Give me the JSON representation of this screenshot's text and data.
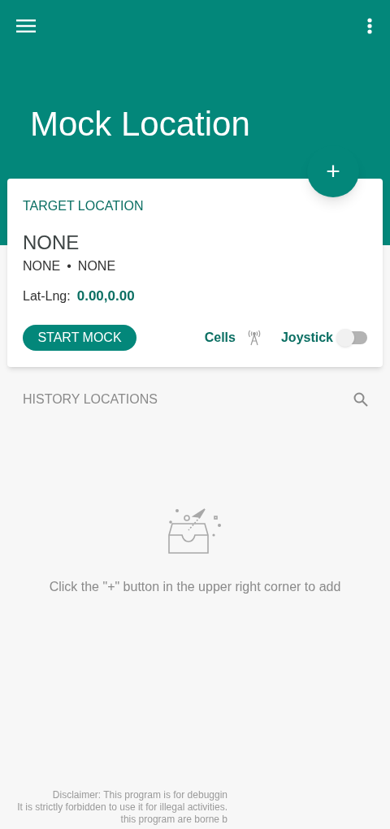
{
  "header": {
    "title": "Mock Location"
  },
  "fab": {
    "label": "+"
  },
  "target": {
    "heading": "TARGET LOCATION",
    "name": "NONE",
    "region": "NONE",
    "separator": "•",
    "locality": "NONE",
    "latlng_label": "Lat-Lng:",
    "latlng_value": "0.00,0.00",
    "start_button": "START MOCK",
    "cells_label": "Cells",
    "joystick": {
      "label": "Joystick",
      "on": false
    }
  },
  "history": {
    "heading": "HISTORY LOCATIONS",
    "empty_message": "Click the \"+\" button in the upper right corner to add"
  },
  "disclaimer": [
    "Disclaimer: This program is for debuggin",
    "It is strictly forbidden to use it for illegal activities.",
    "this program are borne b"
  ]
}
